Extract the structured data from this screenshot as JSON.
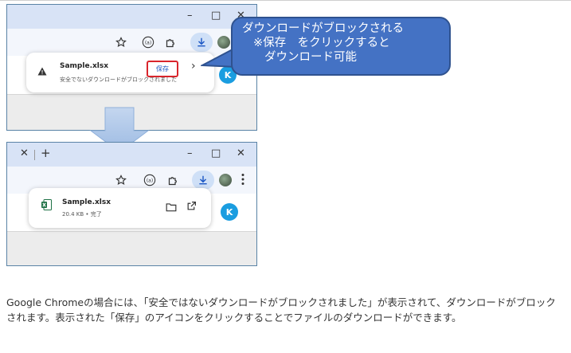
{
  "screenshot1": {
    "window_controls": {
      "minimize": "–",
      "maximize": "□",
      "close": "✕"
    },
    "toolbar_icons": [
      "star-icon",
      "reader-icon",
      "extension-icon",
      "download-icon"
    ],
    "download_popup": {
      "file_name": "Sample.xlsx",
      "status": "安全でないダウンロードがブロックされました",
      "save_label": "保存",
      "chevron": "›"
    },
    "avatar_letter": "K"
  },
  "callout": {
    "line1": "ダウンロードがブロックされる",
    "line2": "※保存　をクリックすると",
    "line3": "ダウンロード可能",
    "color": "#4472c4"
  },
  "screenshot2": {
    "tab_controls": {
      "close": "✕",
      "new_tab": "+"
    },
    "window_controls": {
      "minimize": "–",
      "maximize": "□",
      "close": "✕"
    },
    "toolbar_icons": [
      "star-icon",
      "reader-icon",
      "extension-icon",
      "download-icon",
      "more-icon"
    ],
    "download_popup": {
      "file_name": "Sample.xlsx",
      "status": "20.4 KB • 完了"
    },
    "avatar_letter": "K"
  },
  "caption": "Google Chromeの場合には、「安全ではないダウンロードがブロックされました」が表示されて、ダウンロードがブロックされます。表示された「保存」のアイコンをクリックすることでファイルのダウンロードができます。"
}
